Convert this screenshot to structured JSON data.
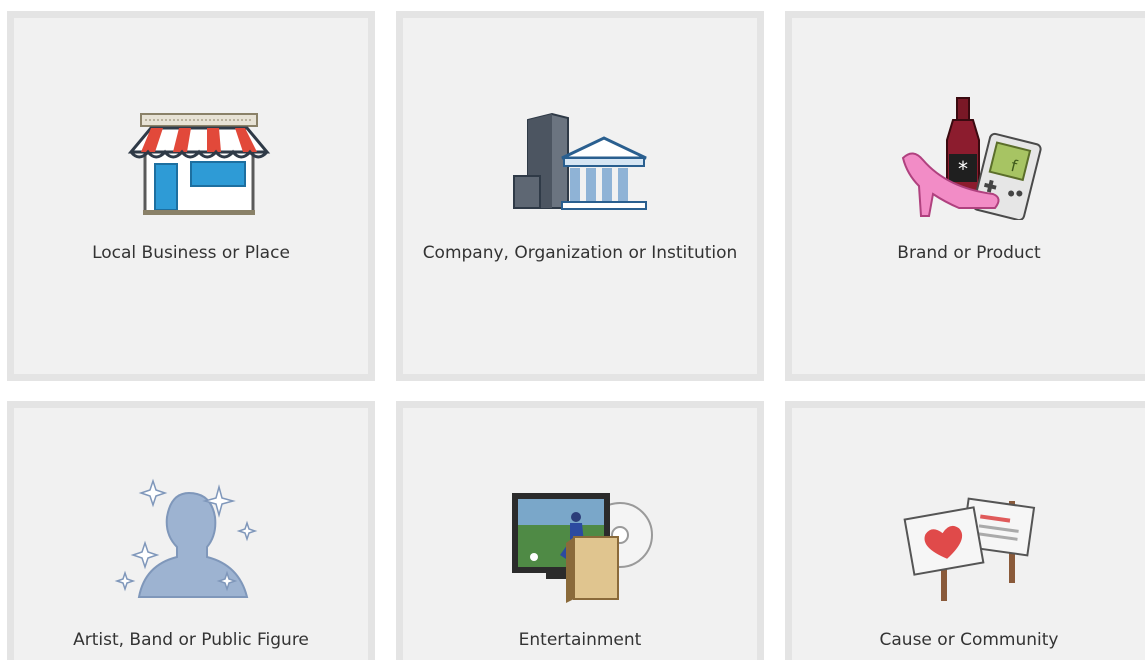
{
  "categories": [
    {
      "label": "Local Business or Place",
      "icon": "storefront-icon"
    },
    {
      "label": "Company, Organization or Institution",
      "icon": "office-building-icon"
    },
    {
      "label": "Brand or Product",
      "icon": "products-icon"
    },
    {
      "label": "Artist, Band or Public Figure",
      "icon": "public-figure-icon"
    },
    {
      "label": "Entertainment",
      "icon": "tv-dvd-book-icon"
    },
    {
      "label": "Cause or Community",
      "icon": "protest-signs-icon"
    }
  ],
  "colors": {
    "tile_background": "#f1f1f1",
    "tile_border": "#e4e4e4",
    "label_text": "#333333"
  }
}
